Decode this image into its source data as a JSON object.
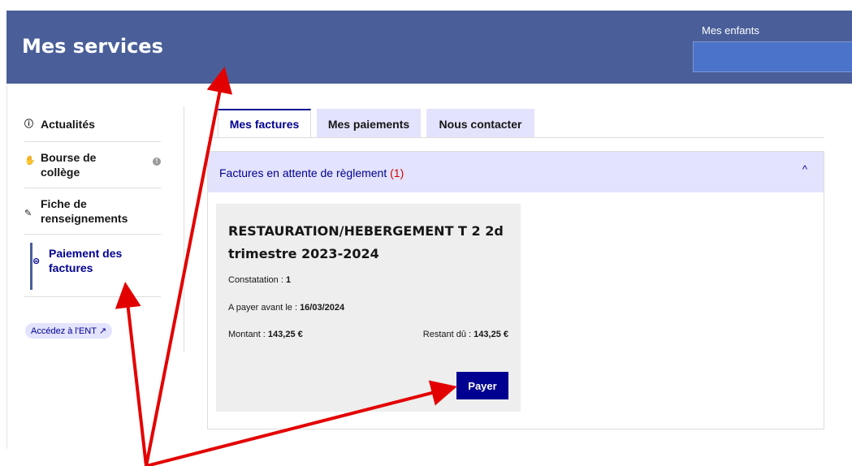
{
  "header": {
    "title": "Mes services",
    "children_label": "Mes enfants",
    "children_value": ""
  },
  "sidebar": {
    "items": [
      {
        "icon": "ⓘ",
        "label": "Actualités"
      },
      {
        "icon": "✋",
        "label": "Bourse de collège",
        "badge": "!"
      },
      {
        "icon": "✎",
        "label": "Fiche de renseignements"
      },
      {
        "icon": "⊜",
        "label": "Paiement des factures",
        "active": true
      }
    ],
    "ent_link": "Accédez à l'ENT ↗"
  },
  "tabs": [
    {
      "label": "Mes factures",
      "active": true
    },
    {
      "label": "Mes paiements"
    },
    {
      "label": "Nous contacter"
    }
  ],
  "accordion": {
    "title": "Factures en attente de règlement ",
    "count": "(1)",
    "chevron": "^"
  },
  "invoice": {
    "title": "RESTAURATION/HEBERGEMENT T 2 2d trimestre 2023-2024",
    "constatation_label": "Constatation : ",
    "constatation_value": "1",
    "due_label": "A payer avant le : ",
    "due_value": "16/03/2024",
    "amount_label": "Montant : ",
    "amount_value": "143,25 €",
    "remaining_label": "Restant dû : ",
    "remaining_value": "143,25 €",
    "pay_button": "Payer"
  },
  "colors": {
    "header": "#4a5f99",
    "primary": "#000091",
    "tab_bg": "#e3e3fd",
    "alert": "#ce0500",
    "annotation": "#e30000"
  }
}
